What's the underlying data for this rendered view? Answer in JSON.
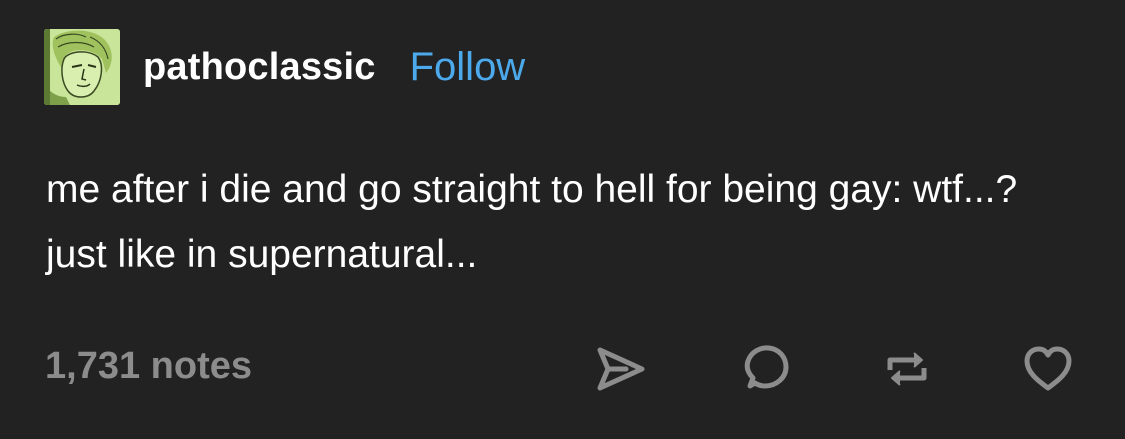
{
  "post": {
    "author": {
      "username": "pathoclassic",
      "avatar_icon": "portrait-avatar",
      "follow_label": "Follow"
    },
    "text": "me after i die and go straight to hell for being gay: wtf...? just like in supernatural...",
    "footer": {
      "notes": "1,731 notes",
      "actions": [
        {
          "name": "share",
          "icon": "paper-plane-icon"
        },
        {
          "name": "reply",
          "icon": "speech-bubble-icon"
        },
        {
          "name": "reblog",
          "icon": "reblog-icon"
        },
        {
          "name": "like",
          "icon": "heart-icon"
        }
      ]
    }
  },
  "colors": {
    "background": "#222222",
    "text": "#ffffff",
    "follow": "#4ca9ec",
    "muted": "#8c8c8c",
    "avatar_bg": "#c9e59a"
  }
}
